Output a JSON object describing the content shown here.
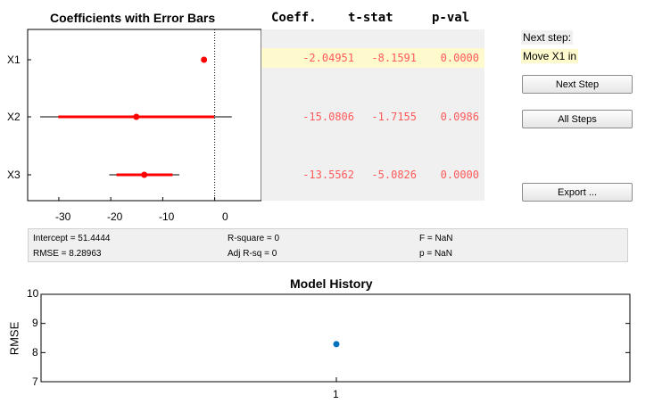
{
  "coef_plot": {
    "title": "Coefficients with Error Bars",
    "x_ticks": [
      "-30",
      "-20",
      "-10",
      "0"
    ],
    "chart_data": {
      "type": "scatter",
      "title": "Coefficients with Error Bars",
      "xlim": [
        -36,
        9
      ],
      "categories": [
        "X1",
        "X2",
        "X3"
      ],
      "points": [
        {
          "label": "X1",
          "coef": -2.04951,
          "in_model": false
        },
        {
          "label": "X2",
          "coef": -15.0806,
          "inner": [
            -30.1,
            -0.1
          ],
          "outer": [
            -33.6,
            3.3
          ],
          "in_model": false
        },
        {
          "label": "X3",
          "coef": -13.5562,
          "inner": [
            -18.9,
            -8.1
          ],
          "outer": [
            -20.3,
            -6.8
          ],
          "in_model": false
        }
      ],
      "zero_line": 0
    }
  },
  "table": {
    "headers": {
      "coeff": "Coeff.",
      "tstat": "t-stat",
      "pval": "p-val"
    },
    "rows": [
      {
        "coeff": "-2.04951",
        "tstat": "-8.1591",
        "pval": "0.0000",
        "highlight": true
      },
      {
        "coeff": "-15.0806",
        "tstat": "-1.7155",
        "pval": "0.0986",
        "highlight": false
      },
      {
        "coeff": "-13.5562",
        "tstat": "-5.0826",
        "pval": "0.0000",
        "highlight": false
      }
    ]
  },
  "side": {
    "next_step_label": "Next step:",
    "next_step_value": "Move X1 in",
    "next_step_button": "Next Step",
    "all_steps_button": "All Steps",
    "export_button": "Export ..."
  },
  "stats": {
    "intercept": "Intercept = 51.4444",
    "rmse": "RMSE = 8.28963",
    "rsquare": "R-square = 0",
    "adj_rsq": "Adj R-sq = 0",
    "f": "F = NaN",
    "p": "p = NaN"
  },
  "history": {
    "title": "Model History",
    "ylabel": "RMSE",
    "y_ticks": [
      "7",
      "8",
      "9",
      "10"
    ],
    "x_ticks": [
      "1"
    ],
    "chart_data": {
      "type": "scatter",
      "title": "Model History",
      "ylabel": "RMSE",
      "ylim": [
        7,
        10
      ],
      "x": [
        1
      ],
      "y": [
        8.28963
      ],
      "color": "#0072bd"
    }
  },
  "colors": {
    "error_bar": "#ff0000",
    "point": "#ff0000",
    "history_point": "#0072bd",
    "highlight": "#fffacd",
    "text_red": "#ff5a5a"
  }
}
